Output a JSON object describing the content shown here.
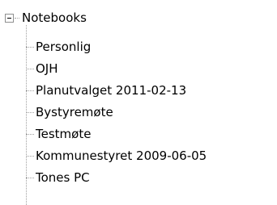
{
  "tree": {
    "root": {
      "label": "Notebooks",
      "expander_icon": "minus-box-icon",
      "expanded": true
    },
    "children": [
      {
        "label": "Personlig"
      },
      {
        "label": "OJH"
      },
      {
        "label": "Planutvalget 2011-02-13"
      },
      {
        "label": "Bystyremøte"
      },
      {
        "label": "Testmøte"
      },
      {
        "label": "Kommunestyret 2009-06-05"
      },
      {
        "label": "Tones PC"
      }
    ]
  }
}
